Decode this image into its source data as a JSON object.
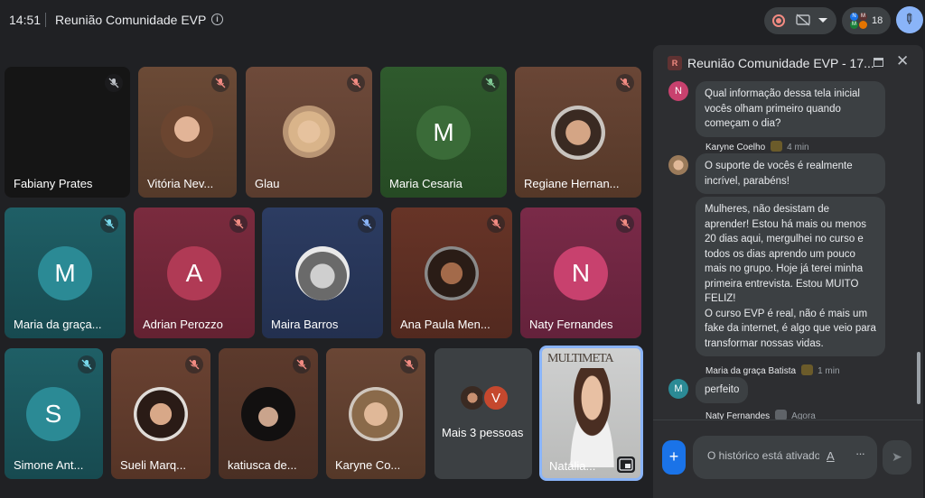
{
  "topbar": {
    "time": "14:51",
    "title": "Reunião Comunidade EVP",
    "info_glyph": "i",
    "participant_count": "18"
  },
  "tiles": [
    {
      "name": "Fabiany Prates",
      "kind": "blank"
    },
    {
      "name": "Vitória Nev...",
      "kind": "photo"
    },
    {
      "name": "Glau",
      "kind": "photo"
    },
    {
      "name": "Maria Cesaria",
      "kind": "letter",
      "letter": "M"
    },
    {
      "name": "Regiane Hernan...",
      "kind": "photo"
    },
    {
      "name": "Maria da graça...",
      "kind": "letter",
      "letter": "M"
    },
    {
      "name": "Adrian Perozzo",
      "kind": "letter",
      "letter": "A"
    },
    {
      "name": "Maira Barros",
      "kind": "photo"
    },
    {
      "name": "Ana Paula Men...",
      "kind": "photo"
    },
    {
      "name": "Naty Fernandes",
      "kind": "letter",
      "letter": "N"
    },
    {
      "name": "Simone Ant...",
      "kind": "letter",
      "letter": "S"
    },
    {
      "name": "Sueli Marq...",
      "kind": "photo"
    },
    {
      "name": "katiusca de...",
      "kind": "photo"
    },
    {
      "name": "Karyne Co...",
      "kind": "photo"
    },
    {
      "name": "Mais 3 pessoas",
      "kind": "more",
      "letter": "V"
    },
    {
      "name": "Natália...",
      "kind": "self",
      "overlay_text": "MULTIMETA"
    }
  ],
  "chat": {
    "title": "Reunião Comunidade EVP - 17...",
    "logo_letter": "R",
    "messages": [
      {
        "avatar": "N",
        "text": "Qual informação dessa tela inicial vocês olham primeiro quando começam o dia?"
      },
      {
        "sender": "Karyne Coelho",
        "time": "4 min",
        "text": "O suporte de vocês é realmente incrível, parabéns!"
      },
      {
        "text": "Mulheres, não desistam de aprender! Estou há mais ou menos 20 dias aqui, mergulhei no curso e todos os dias aprendo um pouco mais no grupo. Hoje já terei minha primeira entrevista. Estou MUITO FELIZ!\nO curso EVP é real, não é mais um fake da internet, é algo que veio para transformar nossas vidas."
      },
      {
        "sender": "Maria da graça Batista",
        "time": "1 min",
        "avatar": "M",
        "text": "perfeito"
      },
      {
        "sender": "Naty Fernandes",
        "time": "Agora"
      }
    ],
    "input_placeholder": "O histórico está ativado",
    "format_glyph": "A",
    "more_glyph": "···",
    "plus_glyph": "+",
    "send_glyph": "➤",
    "close_glyph": "✕"
  }
}
